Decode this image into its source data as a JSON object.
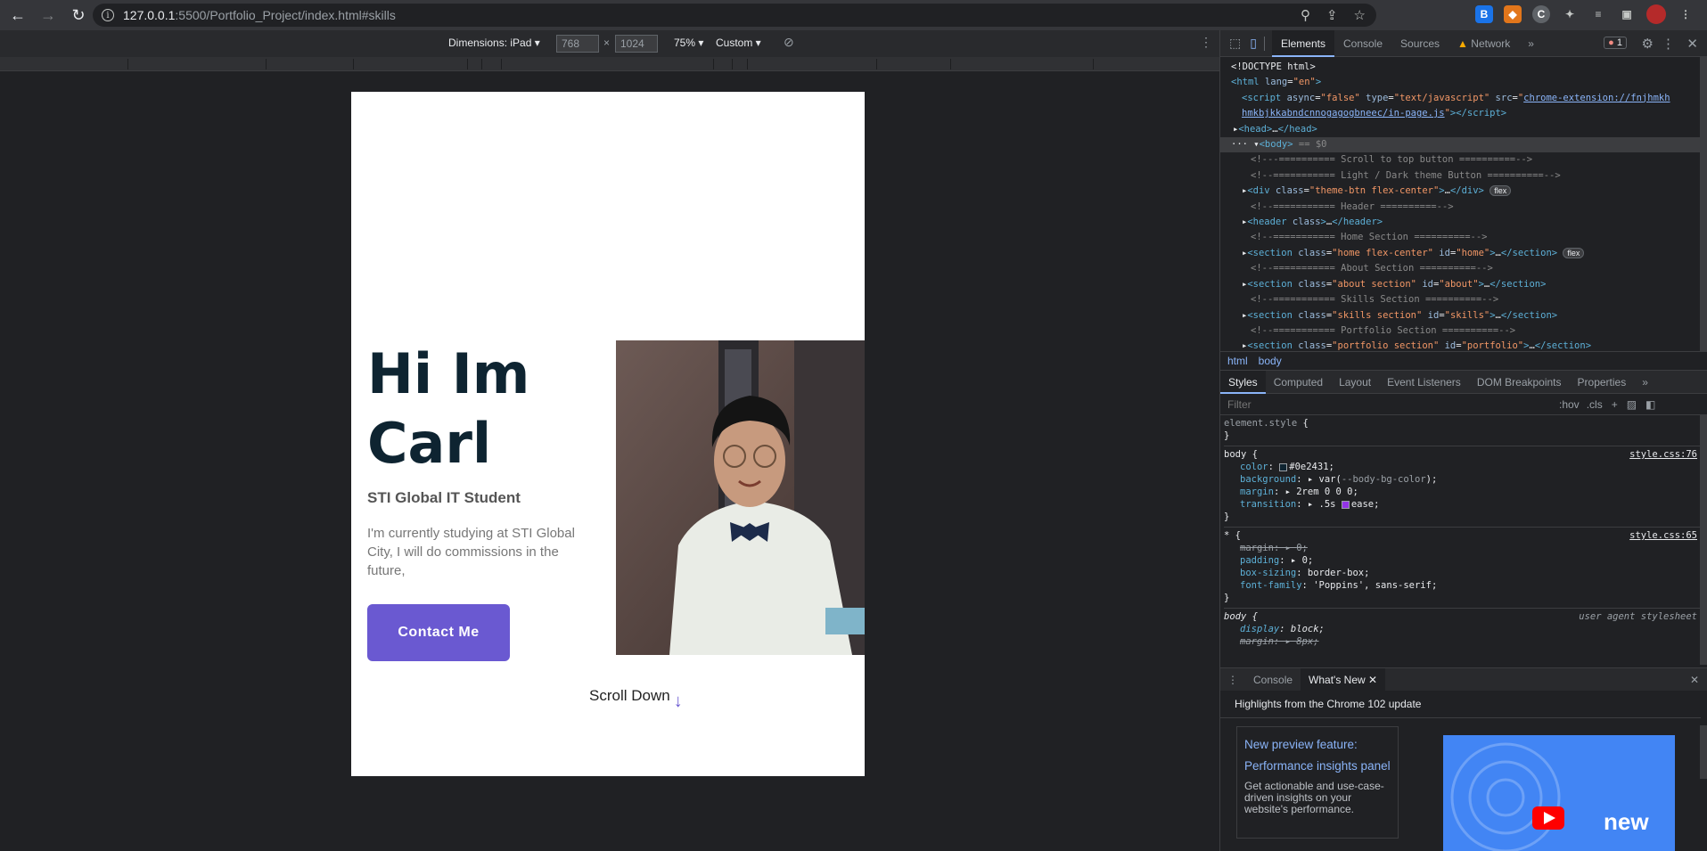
{
  "browser": {
    "url_host": "127.0.0.1",
    "url_path": ":5500/Portfolio_Project/index.html#skills"
  },
  "device_toolbar": {
    "dimensions_label": "Dimensions: iPad",
    "width": "768",
    "height": "1024",
    "times": "×",
    "zoom": "75%",
    "throttle": "Custom"
  },
  "page": {
    "hero_title": "Hi Im Carl",
    "subtitle": "STI Global IT Student",
    "description": "I'm currently studying at STI Global City, I will do commissions in the future,",
    "contact_button": "Contact Me",
    "scroll_down": "Scroll Down",
    "scroll_arrow": "↓"
  },
  "devtools": {
    "tabs": [
      "Elements",
      "Console",
      "Sources",
      "Network"
    ],
    "more_tabs": "»",
    "error_count": "1",
    "breadcrumb": [
      "html",
      "body"
    ],
    "style_tabs": [
      "Styles",
      "Computed",
      "Layout",
      "Event Listeners",
      "DOM Breakpoints",
      "Properties"
    ],
    "filter_placeholder": "Filter",
    "hov": ":hov",
    "cls": ".cls",
    "drawer_tabs": [
      "Console",
      "What's New"
    ],
    "whats_new_header": "Highlights from the Chrome 102 update",
    "whats_new_title": "New preview feature: Performance insights panel",
    "whats_new_desc": "Get actionable and use-case-driven insights on your website's performance.",
    "video_label": "new"
  },
  "colors": {
    "accent": "#6a59d1",
    "text_dark": "#0e2431",
    "devtools_bg": "#202124"
  }
}
